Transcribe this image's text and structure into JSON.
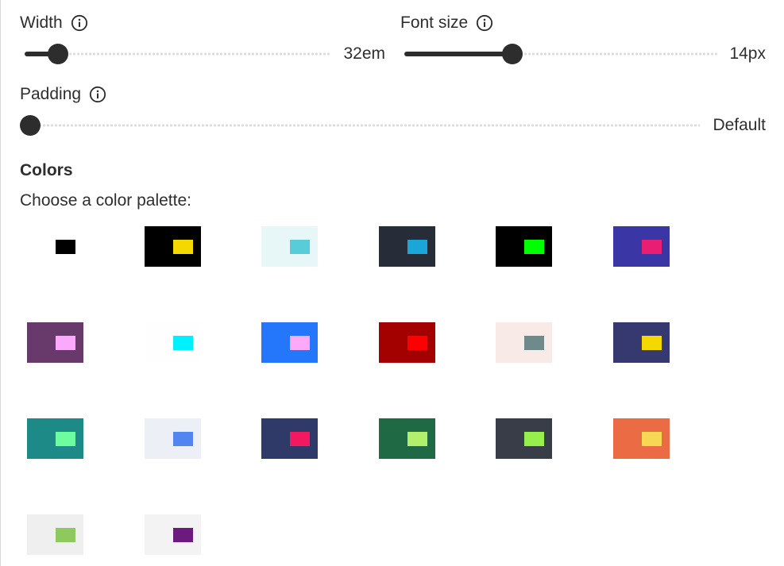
{
  "sliders": {
    "width": {
      "label": "Width",
      "value": "32em",
      "fraction": 0.11
    },
    "font_size": {
      "label": "Font size",
      "value": "14px",
      "fraction": 0.345
    },
    "padding": {
      "label": "Padding",
      "value": "Default",
      "fraction": 0.0
    }
  },
  "colors": {
    "title": "Colors",
    "subtitle": "Choose a color palette:",
    "palettes": [
      {
        "bg": "#ffffff",
        "fg": "#000000"
      },
      {
        "bg": "#000000",
        "fg": "#f5d800"
      },
      {
        "bg": "#e7f6f6",
        "fg": "#58cdd9"
      },
      {
        "bg": "#262d38",
        "fg": "#1aa6d8"
      },
      {
        "bg": "#000000",
        "fg": "#00ff00"
      },
      {
        "bg": "#3a36a6",
        "fg": "#e91e73"
      },
      {
        "bg": "#683a6b",
        "fg": "#fbaafb"
      },
      {
        "bg": "#fefefe",
        "fg": "#00f0ff"
      },
      {
        "bg": "#2476fb",
        "fg": "#fcaaf8"
      },
      {
        "bg": "#a30000",
        "fg": "#ff0000"
      },
      {
        "bg": "#f8eae7",
        "fg": "#6f8a8a"
      },
      {
        "bg": "#363970",
        "fg": "#f5d800"
      },
      {
        "bg": "#1e8a88",
        "fg": "#6dfca0"
      },
      {
        "bg": "#eceff6",
        "fg": "#5285f0"
      },
      {
        "bg": "#303a68",
        "fg": "#f31960"
      },
      {
        "bg": "#206945",
        "fg": "#b2ef6c"
      },
      {
        "bg": "#393d48",
        "fg": "#97ef4c"
      },
      {
        "bg": "#eb6b44",
        "fg": "#f7d855"
      },
      {
        "bg": "#efefef",
        "fg": "#8ec95e"
      },
      {
        "bg": "#f3f3f3",
        "fg": "#6d1a7e"
      }
    ]
  },
  "icons": {
    "info": "info-circle-icon"
  }
}
